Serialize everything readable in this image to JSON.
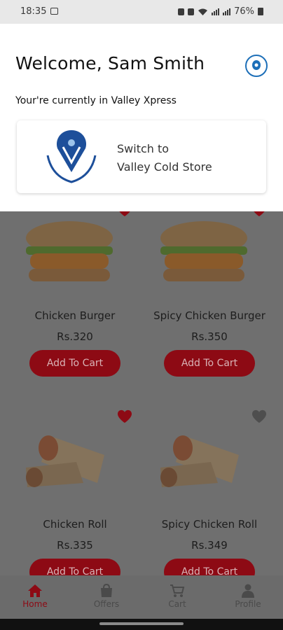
{
  "status_bar": {
    "time": "18:35",
    "battery": "76%"
  },
  "header": {
    "welcome": "Welcome, Sam Smith",
    "current_store_text": "Your're currently in Valley Xpress",
    "switch_line1": "Switch to",
    "switch_line2": "Valley Cold Store",
    "logo_text": "Valley Cold Store"
  },
  "products": [
    {
      "name": "Chicken Burger",
      "price": "Rs.320",
      "button": "Add To Cart",
      "favorite": true
    },
    {
      "name": "Spicy Chicken Burger",
      "price": "Rs.350",
      "button": "Add To Cart",
      "favorite": true
    },
    {
      "name": "Chicken Roll",
      "price": "Rs.335",
      "button": "Add To Cart",
      "favorite": true
    },
    {
      "name": "Spicy Chicken Roll",
      "price": "Rs.349",
      "button": "Add To Cart",
      "favorite": false
    }
  ],
  "nav": {
    "home": "Home",
    "offers": "Offers",
    "cart": "Cart",
    "profile": "Profile"
  },
  "colors": {
    "accent": "#8d0a14",
    "overlay": "#6f6f6f",
    "logo_blue": "#1d6fb8"
  }
}
